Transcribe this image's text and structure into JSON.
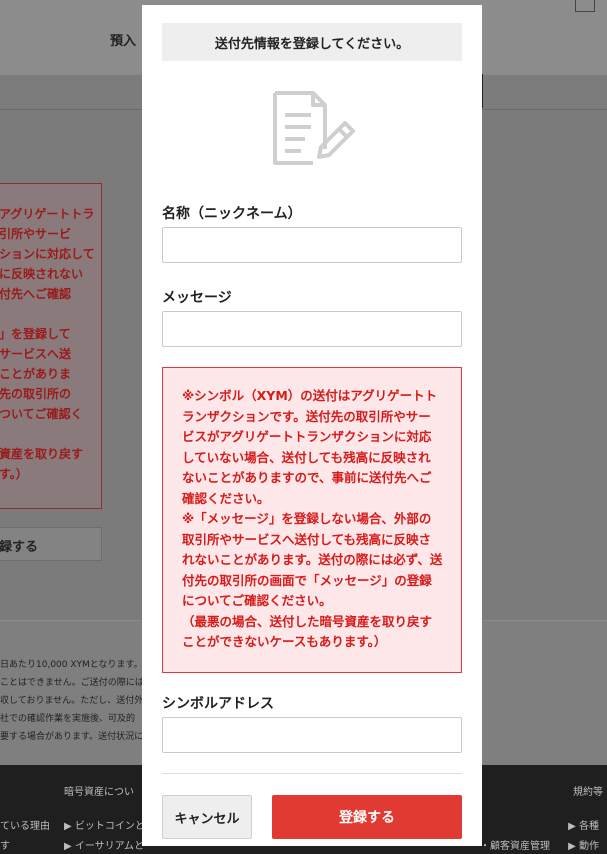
{
  "background": {
    "nav_label": "預入",
    "top_right": "",
    "warning_lines": "アグリゲートトラ\n引所やサービ\nションに対応して\nに反映されない\n付先へご確認\n\n」を登録して\nサービスへ送\nことがありま\n先の取引所の\nついてご確認く\n\n資産を取り戻す\nす。）",
    "button_label": "録する",
    "note_lines": "日あたり10,000 XYMとなります。\nことはできません。ご送付の際には\n収しておりません。ただし、送付外\n社での確認作業を実施後、可及的\n要する場合があります。送付状況につ",
    "footer": {
      "col1_title": "暗号資産につい",
      "col1_item1": "▶ ビットコインと",
      "col1_item2": "▶ イーサリアムと",
      "left_item1": "ている理由",
      "left_item2": "す",
      "right_title": "規約等",
      "right_item1": "▶ 各種",
      "right_item2": "▶ 動作",
      "mid_item": "・顧客資産管理"
    }
  },
  "modal": {
    "title": "送付先情報を登録してください。",
    "icon": "edit-document-icon",
    "name_label": "名称（ニックネーム）",
    "name_value": "",
    "message_label": "メッセージ",
    "message_value": "",
    "warning_1": "※シンボル（XYM）の送付はアグリゲートトランザクションです。送付先の取引所やサービスがアグリゲートトランザクションに対応していない場合、送付しても残高に反映されないことがありますので、事前に送付先へご確認ください。",
    "warning_2": "※「メッセージ」を登録しない場合、外部の取引所やサービスへ送付しても残高に反映されないことがあります。送付の際には必ず、送付先の取引所の画面で「メッセージ」の登録についてご確認ください。",
    "warning_3": "（最悪の場合、送付した暗号資産を取り戻すことができないケースもあります。）",
    "address_label": "シンボルアドレス",
    "address_value": "",
    "cancel_label": "キャンセル",
    "submit_label": "登録する"
  },
  "colors": {
    "accent": "#e03a32",
    "warning_text": "#d71a1a",
    "warning_bg": "#fde7e8"
  }
}
